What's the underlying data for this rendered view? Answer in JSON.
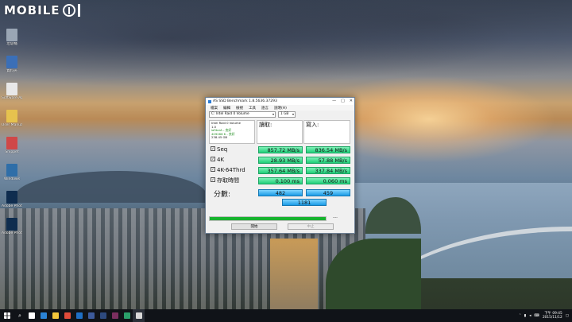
{
  "watermark": {
    "text": "MOBILE"
  },
  "desktop_icons": [
    {
      "label": "垃圾桶",
      "color": "#9aa6b5"
    },
    {
      "label": "資料夾",
      "color": "#3b6fb7"
    },
    {
      "label": "Software Apps 02",
      "color": "#e8e8e8"
    },
    {
      "label": "User Manual",
      "color": "#e6c24e"
    },
    {
      "label": "Snippet",
      "color": "#d04848"
    },
    {
      "label": "Windows",
      "color": "#2f6ea8"
    },
    {
      "label": "Adobe Photoshop",
      "color": "#0f2d4f"
    },
    {
      "label": "Adobe Photoshop",
      "color": "#0f2d4f"
    }
  ],
  "window": {
    "title": "AS SSD Benchmark 1.8.5636.37293",
    "controls": [
      "—",
      "□",
      "✕"
    ],
    "menu": [
      "檔案",
      "編輯",
      "檢視",
      "工具",
      "語言",
      "說明(H)"
    ],
    "drive_select": "C: Intel Raid 0 Volume",
    "size_select": "1 GB",
    "info_lines": [
      "Intel Raid 0 Volume",
      "1.0",
      "iaStorA - 良好",
      "409266 K - 良好",
      "238.45 GB"
    ],
    "col_read": "讀取:",
    "col_write": "寫入:",
    "rows": [
      {
        "label": "Seq",
        "read": "857.72 MB/s",
        "write": "836.54 MB/s"
      },
      {
        "label": "4K",
        "read": "28.93 MB/s",
        "write": "57.88 MB/s"
      },
      {
        "label": "4K-64Thrd",
        "read": "357.64 MB/s",
        "write": "337.84 MB/s"
      },
      {
        "label": "存取時間",
        "read": "0.100 ms",
        "write": "0.060 ms"
      }
    ],
    "score_label": "分數:",
    "score_read": "482",
    "score_write": "459",
    "score_total": "1181",
    "progress": 1.0,
    "progress_text": "----",
    "start_button": "開始",
    "abort_button": "中止"
  },
  "taskbar": {
    "apps": [
      "#ffffff",
      "#2b83d6",
      "#f2c63b",
      "#e04b3a",
      "#1e6fc4",
      "#3d5b9c",
      "#2e4a7e",
      "#7a2f5f",
      "#2a9f6a",
      "#d8d8d8"
    ],
    "time": "下午 09:45",
    "date": "2015/11/12"
  }
}
